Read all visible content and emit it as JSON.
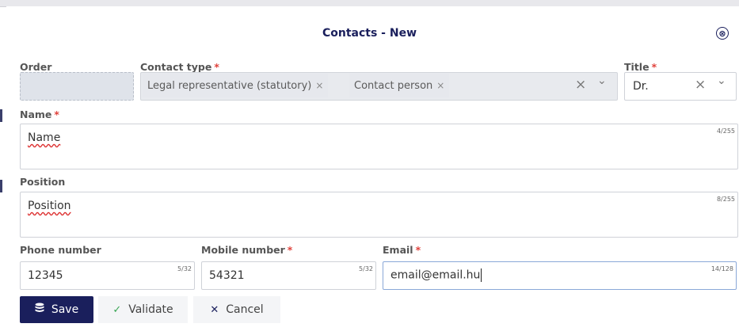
{
  "dialog": {
    "title": "Contacts - New",
    "close_icon": "⊗"
  },
  "fields": {
    "order": {
      "label": "Order",
      "value": ""
    },
    "contact_type": {
      "label": "Contact type",
      "required": "*",
      "chips": [
        {
          "label": "Legal representative (statutory)",
          "remove": "×"
        },
        {
          "label": "Contact person",
          "remove": "×"
        }
      ],
      "clear_icon": "×",
      "dropdown_icon": "⌄"
    },
    "title": {
      "label": "Title",
      "required": "*",
      "value": "Dr.",
      "clear_icon": "×",
      "dropdown_icon": "⌄"
    },
    "name": {
      "label": "Name",
      "required": "*",
      "value": "Name",
      "counter": "4/255"
    },
    "position": {
      "label": "Position",
      "value": "Position",
      "counter": "8/255"
    },
    "phone": {
      "label": "Phone number",
      "value": "12345",
      "counter": "5/32"
    },
    "mobile": {
      "label": "Mobile number",
      "required": "*",
      "value": "54321",
      "counter": "5/32"
    },
    "email": {
      "label": "Email",
      "required": "*",
      "value": "email@email.hu",
      "counter": "14/128"
    }
  },
  "buttons": {
    "save": {
      "label": "Save",
      "icon": "database-icon"
    },
    "validate": {
      "label": "Validate",
      "icon": "✓"
    },
    "cancel": {
      "label": "Cancel",
      "icon": "✕"
    }
  },
  "colors": {
    "primary": "#1a1f5c",
    "required": "#e0413b",
    "validate_check": "#3aa655",
    "email_focus_border": "#8aa8d8"
  }
}
